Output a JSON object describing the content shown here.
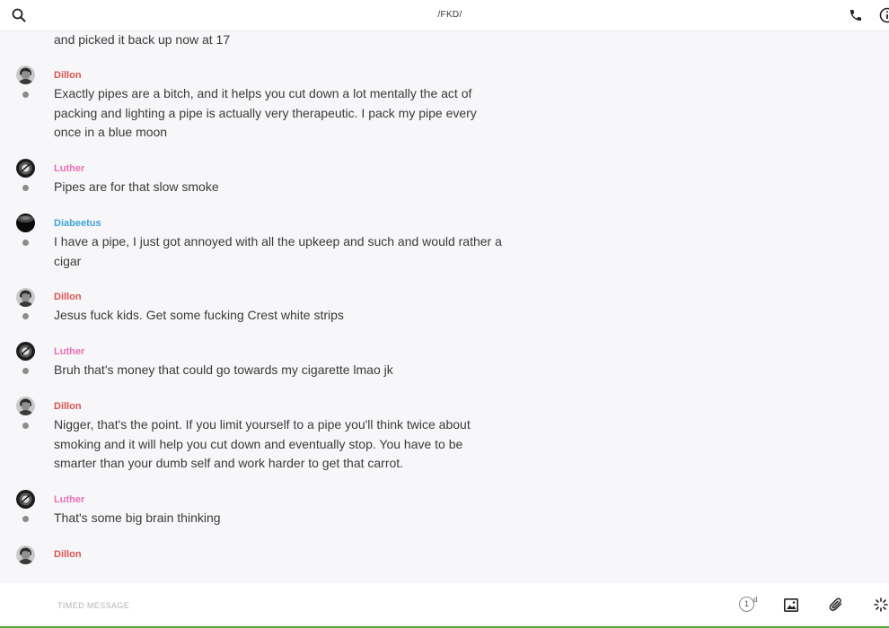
{
  "header": {
    "title": "/FKD/",
    "icons": [
      "search-icon",
      "phone-icon",
      "info-icon"
    ]
  },
  "colors": {
    "Dillon": "#d9534f",
    "Luther": "#e86fb4",
    "Diabeetus": "#3fa4d4",
    "status_dot": "#8c8c8c",
    "bottom_bar": "#56a83e"
  },
  "messages": {
    "partial_top": "and picked it back up now at 17",
    "m1": {
      "author": "Dillon",
      "text": "Exactly pipes are a bitch, and it helps you cut down a lot mentally the act of packing and lighting a pipe is actually very therapeutic. I pack my pipe every once in a blue moon"
    },
    "m2": {
      "author": "Luther",
      "text": "Pipes are for that slow smoke"
    },
    "m3": {
      "author": "Diabeetus",
      "text": "I have a pipe, I just got annoyed with all the upkeep and such and would rather a cigar"
    },
    "m4": {
      "author": "Dillon",
      "text": "Jesus fuck kids. Get some fucking Crest white strips"
    },
    "m5": {
      "author": "Luther",
      "text": "Bruh that's money that could go towards my cigarette lmao jk"
    },
    "m6": {
      "author": "Dillon",
      "text": "Nigger, that's the point. If you limit yourself to a pipe you'll think twice about smoking and it will help you cut down and eventually stop. You have to be smarter than your dumb self and work harder to get that carrot."
    },
    "m7": {
      "author": "Luther",
      "text": "That's some big brain thinking"
    },
    "m8": {
      "author": "Dillon"
    }
  },
  "composer": {
    "placeholder": "TIMED MESSAGE",
    "timer_value": "1",
    "timer_unit": "d",
    "icons": [
      "timer-icon",
      "image-icon",
      "paperclip-icon",
      "loading-spinner-icon"
    ]
  }
}
